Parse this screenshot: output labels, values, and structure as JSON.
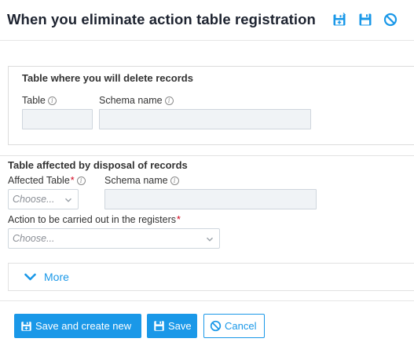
{
  "header": {
    "title": "When you eliminate action table registration",
    "icons": [
      "save-and-new-icon",
      "save-icon",
      "cancel-icon"
    ]
  },
  "section_delete": {
    "title": "Table where you will delete records",
    "table_label": "Table",
    "table_value": "",
    "schema_label": "Schema name",
    "schema_value": ""
  },
  "section_affected": {
    "title": "Table affected by disposal of records",
    "affected_table_label": "Affected Table",
    "required_mark": "*",
    "affected_table_placeholder": "Choose...",
    "schema_label": "Schema name",
    "schema_value": "",
    "action_label": "Action to be carried out in the registers",
    "action_placeholder": "Choose..."
  },
  "more": {
    "label": "More"
  },
  "footer": {
    "save_and_new_label": "Save and create new",
    "save_label": "Save",
    "cancel_label": "Cancel"
  },
  "colors": {
    "accent": "#1a98e8",
    "title": "#1d2330",
    "readonly_bg": "#f0f3f6",
    "required": "#d0021b"
  }
}
